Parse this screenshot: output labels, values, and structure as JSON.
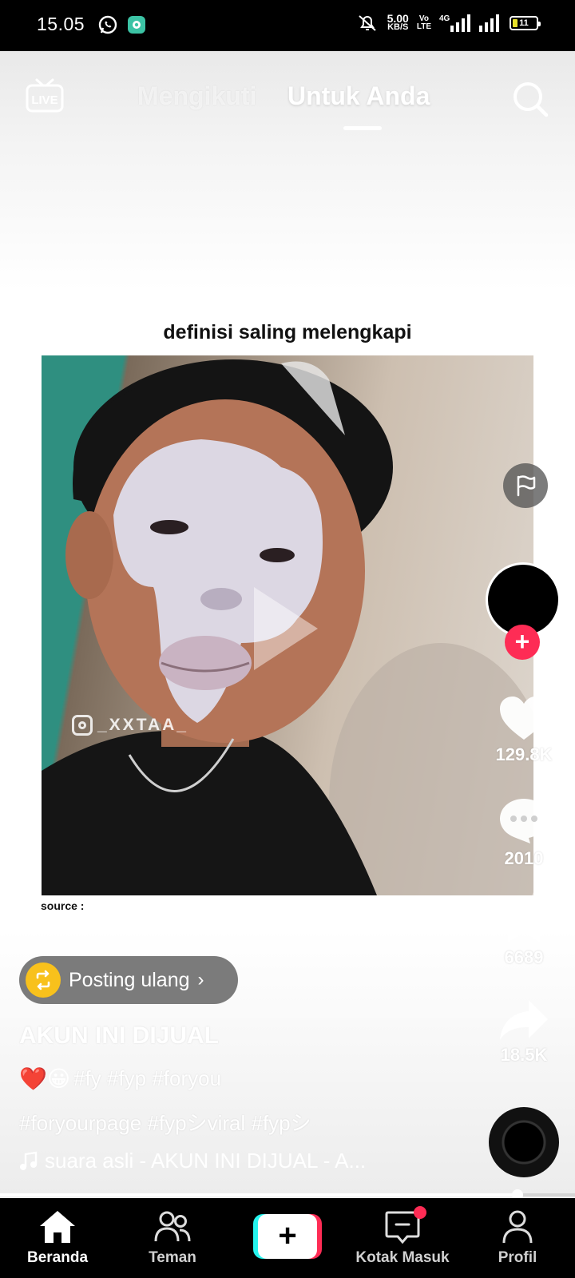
{
  "status_bar": {
    "time": "15.05",
    "net_speed_value": "5.00",
    "net_speed_unit": "KB/S",
    "volte_top": "Vo",
    "volte_bottom": "LTE",
    "network": "4G",
    "battery": "11"
  },
  "top_nav": {
    "tab_following": "Mengikuti",
    "tab_for_you": "Untuk Anda",
    "live_label": "LIVE"
  },
  "video": {
    "caption_top": "definisi saling melengkapi",
    "watermark": "_XXTAA_",
    "source_label": "source :"
  },
  "actions": {
    "likes": "129.8K",
    "comments": "2010",
    "saves": "6689",
    "shares": "18.5K"
  },
  "post": {
    "repost_label": "Posting ulang",
    "username": "AKUN INI DIJUAL",
    "desc_emojis": "❤️😀",
    "desc_line1": "#fy #fyp #foryou",
    "desc_line2": "#foryourpage #fypシviral #fypシ",
    "music": "suara asli - AKUN INI DIJUAL - A..."
  },
  "progress": 0.9,
  "bottom_nav": {
    "home": "Beranda",
    "friends": "Teman",
    "create": "+",
    "inbox": "Kotak Masuk",
    "profile": "Profil"
  },
  "colors": {
    "accent_red": "#fe2c55",
    "accent_cyan": "#25f4ee",
    "repost_yellow": "#f8c11c"
  }
}
